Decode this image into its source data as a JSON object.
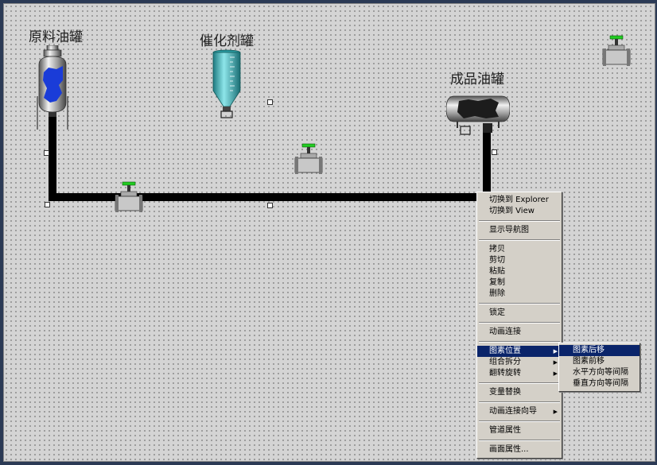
{
  "labels": {
    "raw_tank": "原料油罐",
    "catalyst_tank": "催化剂罐",
    "product_tank": "成品油罐"
  },
  "context_menu": {
    "groups": [
      [
        {
          "label": "切换到 Explorer"
        },
        {
          "label": "切换到 View"
        }
      ],
      [
        {
          "label": "显示导航图"
        }
      ],
      [
        {
          "label": "拷贝"
        },
        {
          "label": "剪切"
        },
        {
          "label": "粘贴"
        },
        {
          "label": "复制"
        },
        {
          "label": "删除"
        }
      ],
      [
        {
          "label": "锁定"
        }
      ],
      [
        {
          "label": "动画连接"
        }
      ],
      [
        {
          "label": "图素位置",
          "submenu": true,
          "selected": true
        },
        {
          "label": "组合拆分",
          "submenu": true
        },
        {
          "label": "翻转旋转",
          "submenu": true
        }
      ],
      [
        {
          "label": "变量替换"
        }
      ],
      [
        {
          "label": "动画连接向导",
          "submenu": true
        }
      ],
      [
        {
          "label": "管道属性"
        }
      ],
      [
        {
          "label": "画面属性..."
        }
      ]
    ]
  },
  "submenu": {
    "items": [
      {
        "label": "图素后移",
        "selected": true
      },
      {
        "label": "图素前移"
      },
      {
        "label": "水平方向等间隔"
      },
      {
        "label": "垂直方向等间隔"
      }
    ]
  },
  "colors": {
    "canvas": "#d4d4d4",
    "pipe": "#000000",
    "tank_fill": "#1a3cd8",
    "catalyst": "#30b8c0",
    "valve_green": "#22cc22",
    "menu_selected": "#0a246a"
  },
  "icons": {
    "raw_tank": "vertical-tank-icon",
    "catalyst_tank": "hopper-tank-icon",
    "product_tank": "horizontal-tank-icon",
    "valve": "valve-icon",
    "submenu_arrow": "triangle-right-icon"
  }
}
